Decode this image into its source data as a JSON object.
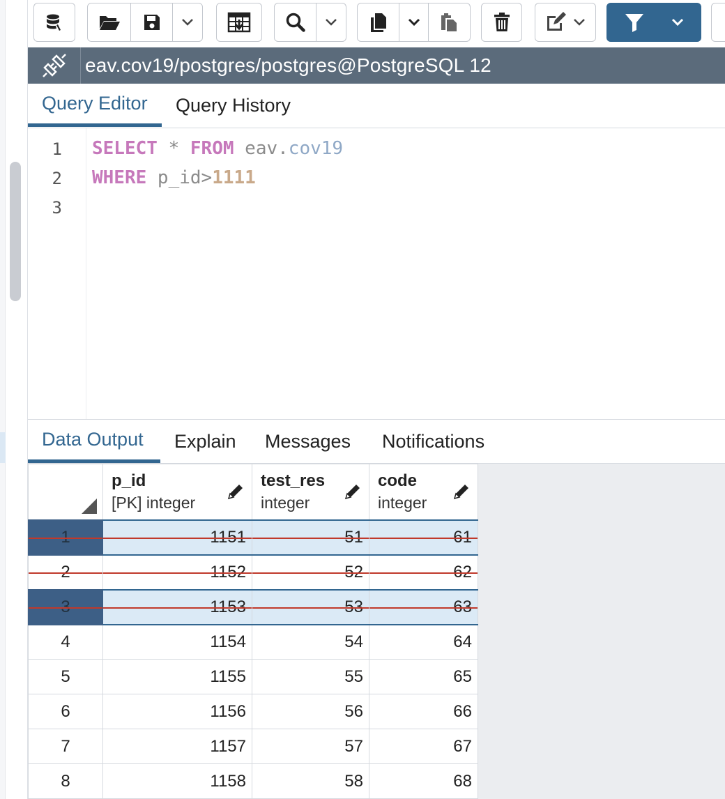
{
  "connection": {
    "title": "eav.cov19/postgres/postgres@PostgreSQL 12"
  },
  "editor_tabs": [
    {
      "label": "Query Editor",
      "active": true
    },
    {
      "label": "Query History",
      "active": false
    }
  ],
  "editor": {
    "line_numbers": [
      "1",
      "2",
      "3"
    ],
    "line1": {
      "kw1": "SELECT",
      "star": " * ",
      "kw2": "FROM",
      "space": " ",
      "schema": "eav",
      "dot": ".",
      "table": "cov19"
    },
    "line2": {
      "kw": "WHERE",
      "ident": " p_id>",
      "num": "1111"
    }
  },
  "output_tabs": [
    {
      "label": "Data Output",
      "active": true
    },
    {
      "label": "Explain",
      "active": false
    },
    {
      "label": "Messages",
      "active": false
    },
    {
      "label": "Notifications",
      "active": false
    }
  ],
  "grid": {
    "columns": [
      {
        "name": "p_id",
        "type": "[PK] integer"
      },
      {
        "name": "test_res",
        "type": "integer"
      },
      {
        "name": "code",
        "type": "integer"
      }
    ],
    "rows": [
      {
        "n": "1",
        "p_id": "1151",
        "test_res": "51",
        "code": "61",
        "selected": true,
        "deleted": true
      },
      {
        "n": "2",
        "p_id": "1152",
        "test_res": "52",
        "code": "62",
        "selected": false,
        "deleted": true
      },
      {
        "n": "3",
        "p_id": "1153",
        "test_res": "53",
        "code": "63",
        "selected": true,
        "deleted": true
      },
      {
        "n": "4",
        "p_id": "1154",
        "test_res": "54",
        "code": "64",
        "selected": false,
        "deleted": false
      },
      {
        "n": "5",
        "p_id": "1155",
        "test_res": "55",
        "code": "65",
        "selected": false,
        "deleted": false
      },
      {
        "n": "6",
        "p_id": "1156",
        "test_res": "56",
        "code": "66",
        "selected": false,
        "deleted": false
      },
      {
        "n": "7",
        "p_id": "1157",
        "test_res": "57",
        "code": "67",
        "selected": false,
        "deleted": false
      },
      {
        "n": "8",
        "p_id": "1158",
        "test_res": "58",
        "code": "68",
        "selected": false,
        "deleted": false
      }
    ]
  },
  "toolbar": {
    "icons": [
      "database-icon",
      "folder-open-icon",
      "save-icon",
      "chevron-down-icon",
      "download-grid-icon",
      "search-icon",
      "chevron-down-icon",
      "copy-icon",
      "chevron-down-icon",
      "paste-icon",
      "trash-icon",
      "edit-icon",
      "filter-icon"
    ],
    "accent_color": "#326690"
  },
  "colors": {
    "accent": "#326690",
    "connection_bar": "#5b6b7b",
    "deleted_strike": "#c0392b",
    "selected_row": "#dbeaf6"
  }
}
